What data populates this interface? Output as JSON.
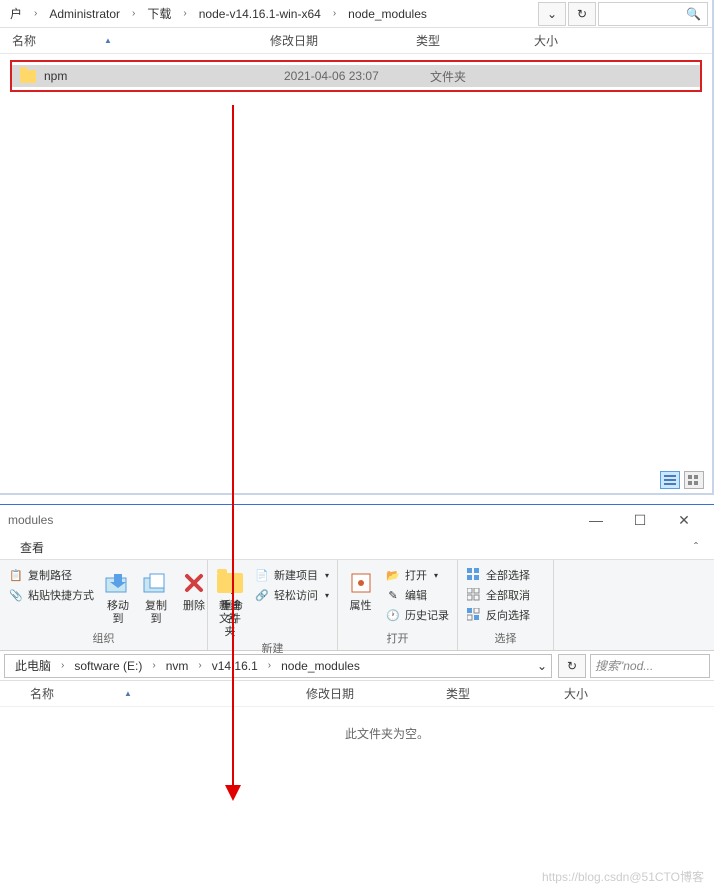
{
  "top": {
    "breadcrumb": [
      "户",
      "Administrator",
      "下载",
      "node-v14.16.1-win-x64",
      "node_modules"
    ],
    "columns": {
      "name": "名称",
      "date": "修改日期",
      "type": "类型",
      "size": "大小"
    },
    "row": {
      "name": "npm",
      "date": "2021-04-06 23:07",
      "type": "文件夹"
    }
  },
  "bottom": {
    "title": "modules",
    "menu": {
      "view": "查看"
    },
    "ribbon": {
      "copypath": "复制路径",
      "pasteshortcut": "粘贴快捷方式",
      "moveto": "移动到",
      "copyto": "复制到",
      "delete": "删除",
      "rename": "重命名",
      "organize_label": "组织",
      "newfolder": "新建\n文件夹",
      "newitem": "新建项目",
      "easyaccess": "轻松访问",
      "new_label": "新建",
      "properties": "属性",
      "open": "打开",
      "edit": "编辑",
      "history": "历史记录",
      "open_label": "打开",
      "selectall": "全部选择",
      "selectnone": "全部取消",
      "invert": "反向选择",
      "select_label": "选择"
    },
    "breadcrumb": [
      "此电脑",
      "software (E:)",
      "nvm",
      "v14.16.1",
      "node_modules"
    ],
    "search_placeholder": "搜索\"nod...",
    "columns": {
      "name": "名称",
      "date": "修改日期",
      "type": "类型",
      "size": "大小"
    },
    "empty": "此文件夹为空。"
  },
  "watermark": "https://blog.csdn@51CTO博客"
}
